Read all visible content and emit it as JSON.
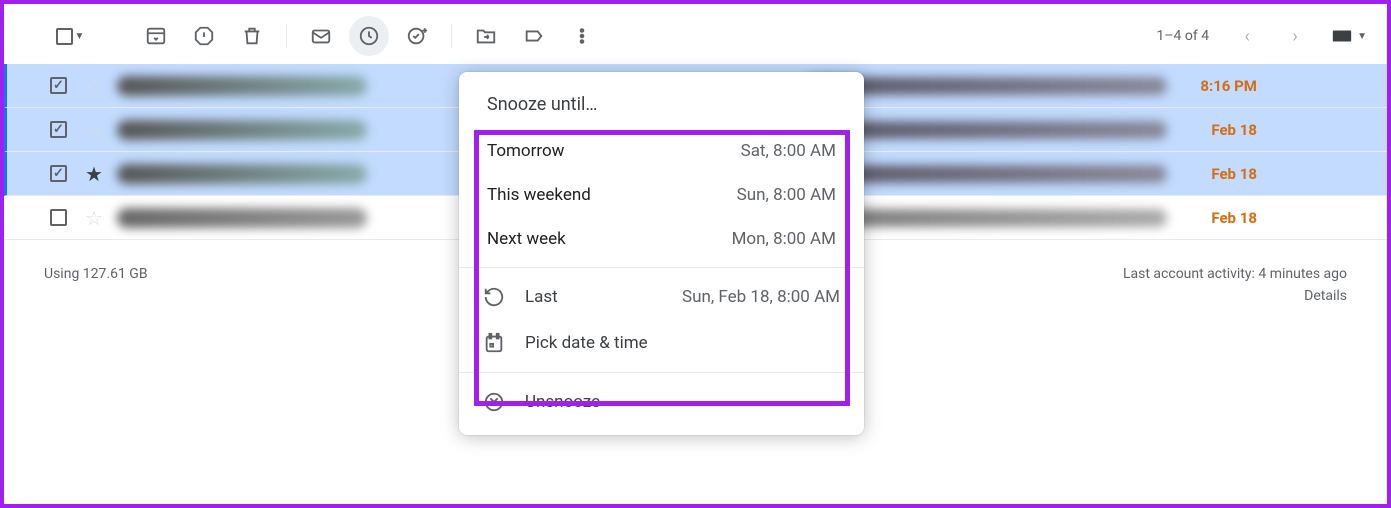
{
  "toolbar": {
    "page_counter": "1–4 of 4"
  },
  "emails": [
    {
      "time": "8:16 PM",
      "selected": true,
      "starred": false
    },
    {
      "time": "Feb 18",
      "selected": true,
      "starred": false
    },
    {
      "time": "Feb 18",
      "selected": true,
      "starred": true
    },
    {
      "time": "Feb 18",
      "selected": false,
      "starred": false
    }
  ],
  "snooze": {
    "title": "Snooze until…",
    "options": [
      {
        "label": "Tomorrow",
        "time": "Sat, 8:00 AM"
      },
      {
        "label": "This weekend",
        "time": "Sun, 8:00 AM"
      },
      {
        "label": "Next week",
        "time": "Mon, 8:00 AM"
      }
    ],
    "last": {
      "label": "Last",
      "time": "Sun, Feb 18, 8:00 AM"
    },
    "pick": "Pick date & time",
    "unsnooze": "Unsnooze"
  },
  "footer": {
    "storage": "Using 127.61 GB",
    "activity": "Last account activity: 4 minutes ago",
    "details": "Details"
  }
}
